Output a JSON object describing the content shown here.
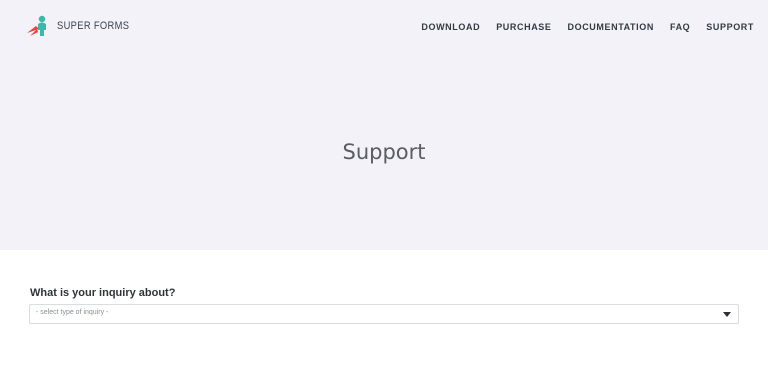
{
  "header": {
    "logo_text": "SUPER FORMS",
    "logo_icon": "superhero-icon",
    "nav": [
      {
        "label": "DOWNLOAD"
      },
      {
        "label": "PURCHASE"
      },
      {
        "label": "DOCUMENTATION"
      },
      {
        "label": "FAQ"
      },
      {
        "label": "SUPPORT"
      }
    ]
  },
  "hero": {
    "title": "Support"
  },
  "form": {
    "inquiry_label": "What is your inquiry about?",
    "inquiry_select": {
      "selected": "- select type of inquiry -",
      "icon": "chevron-down-icon"
    }
  },
  "colors": {
    "hero_background": "#f3f2f8",
    "logo_cape": "#e8433f",
    "logo_figure": "#3cb8a8"
  }
}
